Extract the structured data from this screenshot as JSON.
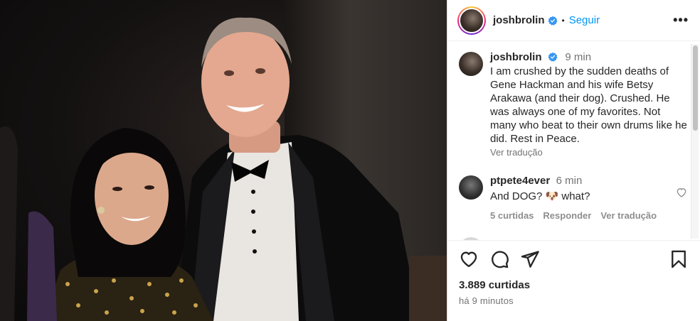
{
  "header": {
    "username": "joshbrolin",
    "separator": "•",
    "follow_label": "Seguir",
    "more_label": "•••"
  },
  "caption": {
    "username": "joshbrolin",
    "time": "9 min",
    "text": "I am crushed by the sudden deaths of Gene Hackman and his wife Betsy Arakawa (and their dog). Crushed. He was always one of my favorites. Not many who beat to their own drums like he did. Rest in Peace.",
    "translate": "Ver tradução"
  },
  "comments": [
    {
      "username": "ptpete4ever",
      "time": "6 min",
      "text": "And DOG? 🐶 what?",
      "likes_label": "5 curtidas",
      "reply_label": "Responder",
      "translate": "Ver tradução"
    }
  ],
  "footer": {
    "likes": "3.889 curtidas",
    "time_ago": "há 9 minutos"
  },
  "colors": {
    "accent": "#0095f6",
    "verified": "#3897f0",
    "muted": "#737373"
  }
}
